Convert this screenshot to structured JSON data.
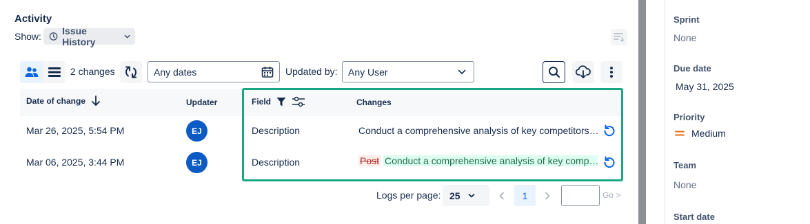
{
  "activity": {
    "title": "Activity",
    "show_label": "Show:",
    "show_value": "Issue History"
  },
  "toolbar": {
    "changes_count": "2 changes",
    "dates_value": "Any dates",
    "updated_by_label": "Updated by:",
    "user_value": "Any User"
  },
  "table": {
    "headers": {
      "date": "Date of change",
      "updater": "Updater",
      "field": "Field",
      "changes": "Changes"
    },
    "rows": [
      {
        "date": "Mar 26, 2025, 5:54 PM",
        "updater_initials": "EJ",
        "field": "Description",
        "change_text": "Conduct a comprehensive analysis of key competitors…"
      },
      {
        "date": "Mar 06, 2025, 3:44 PM",
        "updater_initials": "EJ",
        "field": "Description",
        "old_value": "Post",
        "new_value": "Conduct a comprehensive analysis of key comp…"
      }
    ]
  },
  "pagination": {
    "logs_label": "Logs per page:",
    "per_page": "25",
    "current_page": "1",
    "goto_input": "",
    "go_label": "Go >"
  },
  "sidebar": {
    "sprint_label": "Sprint",
    "sprint_value": "None",
    "due_label": "Due date",
    "due_value": "May 31, 2025",
    "priority_label": "Priority",
    "priority_value": "Medium",
    "team_label": "Team",
    "team_value": "None",
    "start_label": "Start date"
  },
  "colors": {
    "accent": "#0c66e4",
    "avatar": "#0c5bc4",
    "highlight_box": "#1aa682",
    "priority_medium": "#e56910"
  }
}
